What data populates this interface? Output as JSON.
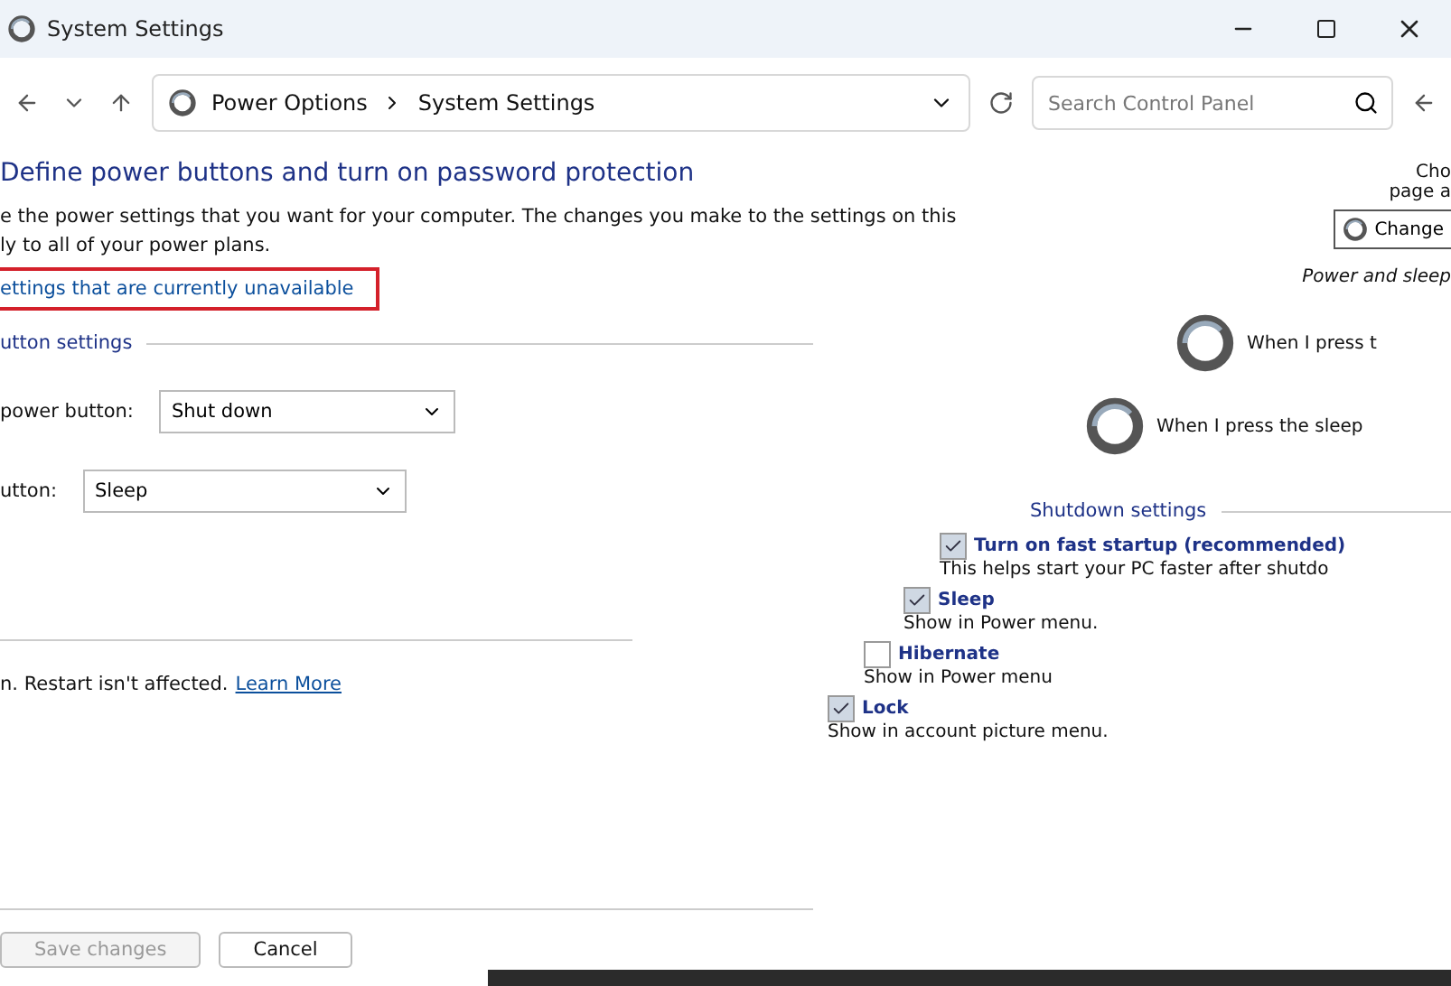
{
  "window": {
    "title": "System Settings"
  },
  "address_bar": {
    "breadcrumbs": [
      "Power Options",
      "System Settings"
    ],
    "search": {
      "placeholder": "Search Control Panel"
    }
  },
  "main": {
    "heading": "Define power buttons and turn on password protection",
    "description": [
      "e the power settings that you want for your computer. The changes you make to the settings on this",
      "ly to all of your power plans."
    ],
    "unavailable_link": {
      "label": "ettings that are currently unavailable",
      "highlighted": true
    },
    "section_title": "utton settings",
    "fields": [
      {
        "label": "power button:",
        "value": "Shut down"
      },
      {
        "label": "utton:",
        "value": "Sleep"
      }
    ],
    "note": "n. Restart isn't affected.",
    "note_link": "Learn More"
  },
  "side": {
    "lines": [
      "Cho",
      "page a"
    ],
    "change_button": "Change",
    "section_title": "Power and sleep",
    "actions": [
      "When I press t",
      "When I press the sleep"
    ],
    "shutdown_title": "Shutdown settings",
    "options": [
      {
        "label": "Turn on fast startup (recommended)",
        "description": "This helps start your PC faster after shutdo",
        "checked": true
      },
      {
        "label": "Sleep",
        "description": "Show in Power menu.",
        "checked": true
      },
      {
        "label": "Hibernate",
        "description": "Show in Power menu",
        "checked": false
      },
      {
        "label": "Lock",
        "description": "Show in account picture menu.",
        "checked": true
      }
    ]
  },
  "buttons": [
    {
      "label": "Save changes",
      "disabled": true
    },
    {
      "label": "Cancel",
      "disabled": false
    }
  ]
}
